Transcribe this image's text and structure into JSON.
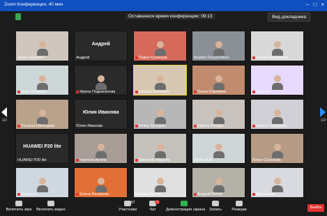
{
  "window": {
    "title": "Zoom Конференция, 40 мин"
  },
  "meeting": {
    "time_left": "Оставшееся время конференции: 09:13",
    "view_button": "Вид докладчика"
  },
  "pager": {
    "left": "1/2",
    "right": "1/2"
  },
  "participants": [
    {
      "name": "Ирина Щукина",
      "muted": false
    },
    {
      "name": "Андрей",
      "muted": false,
      "center_label": "Андрей"
    },
    {
      "name": "Павел Кузнецов",
      "muted": true
    },
    {
      "name": "Anatolii Ovsyannikov",
      "muted": false
    },
    {
      "name": "Никита Бешенцев",
      "muted": true
    },
    {
      "name": "Gleb Shepelev",
      "muted": true
    },
    {
      "name": "Ирина Подкатилова",
      "muted": true
    },
    {
      "name": "Катюша Валерия",
      "muted": true
    },
    {
      "name": "Ольга Сорокина",
      "muted": true
    },
    {
      "name": "Евгения",
      "muted": true
    },
    {
      "name": "Татьяна Мальцева",
      "muted": true
    },
    {
      "name": "Юлия Иванова",
      "muted": false,
      "center_label": "Юлия Иванова"
    },
    {
      "name": "Dmitry Бутырин",
      "muted": true
    },
    {
      "name": "Никита Ручкин",
      "muted": true
    },
    {
      "name": "Никита Чубарцев",
      "muted": true
    },
    {
      "name": "HUAWEI P20 lite",
      "muted": false,
      "center_label": "HUAWEI P20 lite"
    },
    {
      "name": "Чертков Артем",
      "muted": true
    },
    {
      "name": "Дмитрий Абдулин",
      "muted": true
    },
    {
      "name": "Лялин В.В.",
      "muted": false
    },
    {
      "name": "Юлия Суханова",
      "muted": false
    },
    {
      "name": "Наташа Н",
      "muted": true
    },
    {
      "name": "Елена Вяхирева",
      "muted": true
    },
    {
      "name": "Максим Зотин",
      "muted": false
    },
    {
      "name": "Андрей Попов",
      "muted": true
    },
    {
      "name": "Дробышев",
      "muted": true
    }
  ],
  "toolbar": {
    "mute": "Включить звук",
    "video": "Включить видео",
    "participants": "Участники",
    "participants_count": "57",
    "chat": "Чат",
    "chat_badge": "4",
    "share": "Демонстрация экрана",
    "record": "Запись",
    "reactions": "Реакции",
    "leave": "Выйти"
  },
  "colors": {
    "title_bar": "#0f4fbf",
    "leave": "#e0332f",
    "active_border": "#f2d23d",
    "share_icon": "#2fb24c"
  }
}
